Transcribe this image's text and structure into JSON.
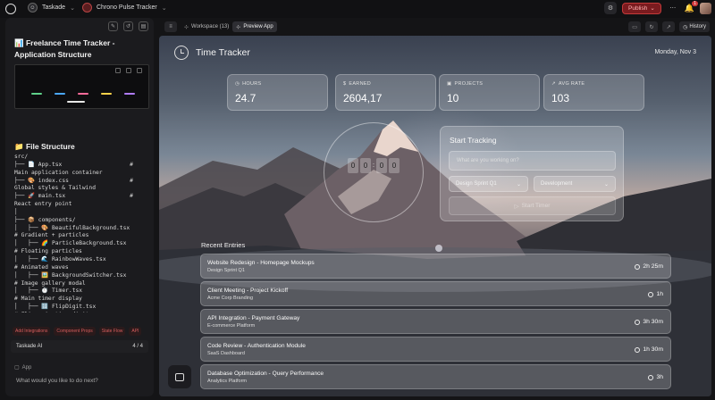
{
  "topbar": {
    "workspace_name": "Taskade",
    "project_name": "Chrono Pulse Tracker",
    "publish_label": "Publish",
    "notification_count": "1"
  },
  "left_panel": {
    "doc_title": "📊 Freelance Time Tracker - Application Structure",
    "file_structure_title": "📁 File Structure",
    "code_lines": [
      "src/",
      "├── 📄 App.tsx                    #",
      "Main application container",
      "├── 🎨 index.css                  #",
      "Global styles & Tailwind",
      "├── 🚀 main.tsx                   #",
      "React entry point",
      "│",
      "├── 📦 components/",
      "│   ├── 🎨 BeautifulBackground.tsx",
      "# Gradient + particles",
      "│   ├── 🌈 ParticleBackground.tsx",
      "# Floating particles",
      "│   ├── 🌊 RainbowWaves.tsx",
      "# Animated waves",
      "│   ├── 🖼️ BackgroundSwitcher.tsx",
      "# Image gallery modal",
      "│   ├── ⏱️ Timer.tsx",
      "# Main timer display",
      "│   ├── 🔢 FlipDigit.tsx",
      "# Flip animation digits"
    ],
    "chips": [
      "Add Integrations",
      "Component Props",
      "State Flow",
      "API"
    ],
    "ai_label": "Taskade AI",
    "ai_count": "4 / 4",
    "app_tag": "App",
    "prompt_placeholder": "What would you like to do next?"
  },
  "preview_bar": {
    "tabs": [
      "Workspace (13)",
      "Preview App"
    ],
    "history_label": "History"
  },
  "app": {
    "title": "Time Tracker",
    "date": "Monday, Nov 3",
    "stats": [
      {
        "label": "HOURS",
        "value": "24.7",
        "icon": "clock-icon"
      },
      {
        "label": "EARNED",
        "value": "2604,17",
        "icon": "dollar-icon"
      },
      {
        "label": "PROJECTS",
        "value": "10",
        "icon": "briefcase-icon"
      },
      {
        "label": "AVG RATE",
        "value": "103",
        "icon": "trend-icon"
      }
    ],
    "timer_digits": [
      "0",
      "0",
      "0",
      "0"
    ],
    "start_tracking": {
      "title": "Start Tracking",
      "placeholder": "What are you working on?",
      "project_value": "Design Sprint Q1",
      "category_value": "Development",
      "button_label": "Start Timer"
    },
    "recent_title": "Recent Entries",
    "entries": [
      {
        "name": "Website Redesign - Homepage Mockups",
        "client": "Design Sprint Q1",
        "duration": "2h 25m"
      },
      {
        "name": "Client Meeting - Project Kickoff",
        "client": "Acme Corp Branding",
        "duration": "1h"
      },
      {
        "name": "API Integration - Payment Gateway",
        "client": "E-commerce Platform",
        "duration": "3h 30m"
      },
      {
        "name": "Code Review - Authentication Module",
        "client": "SaaS Dashboard",
        "duration": "1h 30m"
      },
      {
        "name": "Database Optimization - Query Performance",
        "client": "Analytics Platform",
        "duration": "3h"
      }
    ]
  }
}
